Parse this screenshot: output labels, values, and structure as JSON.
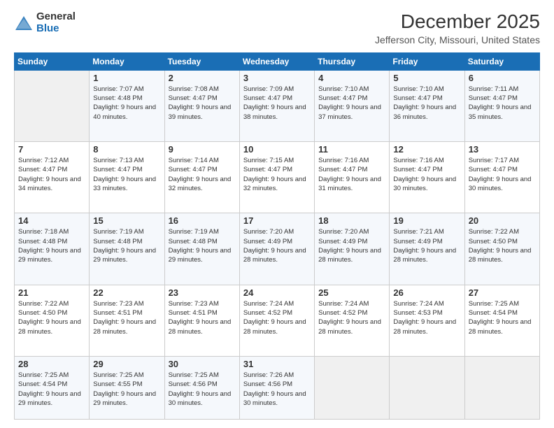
{
  "header": {
    "logo_general": "General",
    "logo_blue": "Blue",
    "month_title": "December 2025",
    "location": "Jefferson City, Missouri, United States"
  },
  "days_of_week": [
    "Sunday",
    "Monday",
    "Tuesday",
    "Wednesday",
    "Thursday",
    "Friday",
    "Saturday"
  ],
  "weeks": [
    [
      {
        "day": "",
        "empty": true
      },
      {
        "day": "1",
        "sunrise": "Sunrise: 7:07 AM",
        "sunset": "Sunset: 4:48 PM",
        "daylight": "Daylight: 9 hours and 40 minutes."
      },
      {
        "day": "2",
        "sunrise": "Sunrise: 7:08 AM",
        "sunset": "Sunset: 4:47 PM",
        "daylight": "Daylight: 9 hours and 39 minutes."
      },
      {
        "day": "3",
        "sunrise": "Sunrise: 7:09 AM",
        "sunset": "Sunset: 4:47 PM",
        "daylight": "Daylight: 9 hours and 38 minutes."
      },
      {
        "day": "4",
        "sunrise": "Sunrise: 7:10 AM",
        "sunset": "Sunset: 4:47 PM",
        "daylight": "Daylight: 9 hours and 37 minutes."
      },
      {
        "day": "5",
        "sunrise": "Sunrise: 7:10 AM",
        "sunset": "Sunset: 4:47 PM",
        "daylight": "Daylight: 9 hours and 36 minutes."
      },
      {
        "day": "6",
        "sunrise": "Sunrise: 7:11 AM",
        "sunset": "Sunset: 4:47 PM",
        "daylight": "Daylight: 9 hours and 35 minutes."
      }
    ],
    [
      {
        "day": "7",
        "sunrise": "Sunrise: 7:12 AM",
        "sunset": "Sunset: 4:47 PM",
        "daylight": "Daylight: 9 hours and 34 minutes."
      },
      {
        "day": "8",
        "sunrise": "Sunrise: 7:13 AM",
        "sunset": "Sunset: 4:47 PM",
        "daylight": "Daylight: 9 hours and 33 minutes."
      },
      {
        "day": "9",
        "sunrise": "Sunrise: 7:14 AM",
        "sunset": "Sunset: 4:47 PM",
        "daylight": "Daylight: 9 hours and 32 minutes."
      },
      {
        "day": "10",
        "sunrise": "Sunrise: 7:15 AM",
        "sunset": "Sunset: 4:47 PM",
        "daylight": "Daylight: 9 hours and 32 minutes."
      },
      {
        "day": "11",
        "sunrise": "Sunrise: 7:16 AM",
        "sunset": "Sunset: 4:47 PM",
        "daylight": "Daylight: 9 hours and 31 minutes."
      },
      {
        "day": "12",
        "sunrise": "Sunrise: 7:16 AM",
        "sunset": "Sunset: 4:47 PM",
        "daylight": "Daylight: 9 hours and 30 minutes."
      },
      {
        "day": "13",
        "sunrise": "Sunrise: 7:17 AM",
        "sunset": "Sunset: 4:47 PM",
        "daylight": "Daylight: 9 hours and 30 minutes."
      }
    ],
    [
      {
        "day": "14",
        "sunrise": "Sunrise: 7:18 AM",
        "sunset": "Sunset: 4:48 PM",
        "daylight": "Daylight: 9 hours and 29 minutes."
      },
      {
        "day": "15",
        "sunrise": "Sunrise: 7:19 AM",
        "sunset": "Sunset: 4:48 PM",
        "daylight": "Daylight: 9 hours and 29 minutes."
      },
      {
        "day": "16",
        "sunrise": "Sunrise: 7:19 AM",
        "sunset": "Sunset: 4:48 PM",
        "daylight": "Daylight: 9 hours and 29 minutes."
      },
      {
        "day": "17",
        "sunrise": "Sunrise: 7:20 AM",
        "sunset": "Sunset: 4:49 PM",
        "daylight": "Daylight: 9 hours and 28 minutes."
      },
      {
        "day": "18",
        "sunrise": "Sunrise: 7:20 AM",
        "sunset": "Sunset: 4:49 PM",
        "daylight": "Daylight: 9 hours and 28 minutes."
      },
      {
        "day": "19",
        "sunrise": "Sunrise: 7:21 AM",
        "sunset": "Sunset: 4:49 PM",
        "daylight": "Daylight: 9 hours and 28 minutes."
      },
      {
        "day": "20",
        "sunrise": "Sunrise: 7:22 AM",
        "sunset": "Sunset: 4:50 PM",
        "daylight": "Daylight: 9 hours and 28 minutes."
      }
    ],
    [
      {
        "day": "21",
        "sunrise": "Sunrise: 7:22 AM",
        "sunset": "Sunset: 4:50 PM",
        "daylight": "Daylight: 9 hours and 28 minutes."
      },
      {
        "day": "22",
        "sunrise": "Sunrise: 7:23 AM",
        "sunset": "Sunset: 4:51 PM",
        "daylight": "Daylight: 9 hours and 28 minutes."
      },
      {
        "day": "23",
        "sunrise": "Sunrise: 7:23 AM",
        "sunset": "Sunset: 4:51 PM",
        "daylight": "Daylight: 9 hours and 28 minutes."
      },
      {
        "day": "24",
        "sunrise": "Sunrise: 7:24 AM",
        "sunset": "Sunset: 4:52 PM",
        "daylight": "Daylight: 9 hours and 28 minutes."
      },
      {
        "day": "25",
        "sunrise": "Sunrise: 7:24 AM",
        "sunset": "Sunset: 4:52 PM",
        "daylight": "Daylight: 9 hours and 28 minutes."
      },
      {
        "day": "26",
        "sunrise": "Sunrise: 7:24 AM",
        "sunset": "Sunset: 4:53 PM",
        "daylight": "Daylight: 9 hours and 28 minutes."
      },
      {
        "day": "27",
        "sunrise": "Sunrise: 7:25 AM",
        "sunset": "Sunset: 4:54 PM",
        "daylight": "Daylight: 9 hours and 28 minutes."
      }
    ],
    [
      {
        "day": "28",
        "sunrise": "Sunrise: 7:25 AM",
        "sunset": "Sunset: 4:54 PM",
        "daylight": "Daylight: 9 hours and 29 minutes."
      },
      {
        "day": "29",
        "sunrise": "Sunrise: 7:25 AM",
        "sunset": "Sunset: 4:55 PM",
        "daylight": "Daylight: 9 hours and 29 minutes."
      },
      {
        "day": "30",
        "sunrise": "Sunrise: 7:25 AM",
        "sunset": "Sunset: 4:56 PM",
        "daylight": "Daylight: 9 hours and 30 minutes."
      },
      {
        "day": "31",
        "sunrise": "Sunrise: 7:26 AM",
        "sunset": "Sunset: 4:56 PM",
        "daylight": "Daylight: 9 hours and 30 minutes."
      },
      {
        "day": "",
        "empty": true
      },
      {
        "day": "",
        "empty": true
      },
      {
        "day": "",
        "empty": true
      }
    ]
  ]
}
